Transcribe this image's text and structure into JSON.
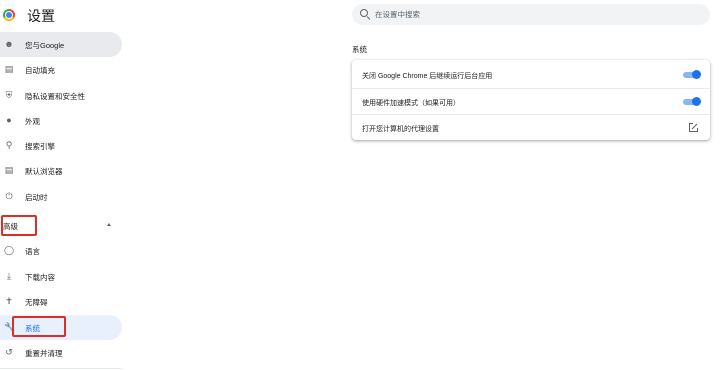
{
  "header": {
    "title": "设置",
    "search_placeholder": "在设置中搜索"
  },
  "sidebar": {
    "items": [
      {
        "label": "您与Google",
        "icon": "person-icon",
        "active": true
      },
      {
        "label": "自动填充",
        "icon": "autofill-icon"
      },
      {
        "label": "隐私设置和安全性",
        "icon": "shield-icon"
      },
      {
        "label": "外观",
        "icon": "palette-icon"
      },
      {
        "label": "搜索引擎",
        "icon": "search-icon"
      },
      {
        "label": "默认浏览器",
        "icon": "browser-icon"
      },
      {
        "label": "启动时",
        "icon": "power-icon"
      }
    ],
    "advanced_label": "高级",
    "advanced_items": [
      {
        "label": "语言",
        "icon": "globe-icon"
      },
      {
        "label": "下载内容",
        "icon": "download-icon"
      },
      {
        "label": "无障碍",
        "icon": "accessibility-icon"
      },
      {
        "label": "系统",
        "icon": "wrench-icon",
        "selected": true
      },
      {
        "label": "重置并清理",
        "icon": "reset-icon"
      }
    ]
  },
  "main": {
    "section_title": "系统",
    "rows": [
      {
        "label": "关闭 Google Chrome 后继续运行后台应用",
        "control": "toggle",
        "enabled": true
      },
      {
        "label": "使用硬件加速模式（如果可用）",
        "control": "toggle",
        "enabled": true
      },
      {
        "label": "打开您计算机的代理设置",
        "control": "external-link"
      }
    ]
  },
  "colors": {
    "accent": "#1a73e8",
    "highlight": "#d93025",
    "active_bg": "#e8eaed",
    "selected_bg": "#e8f0fe"
  }
}
